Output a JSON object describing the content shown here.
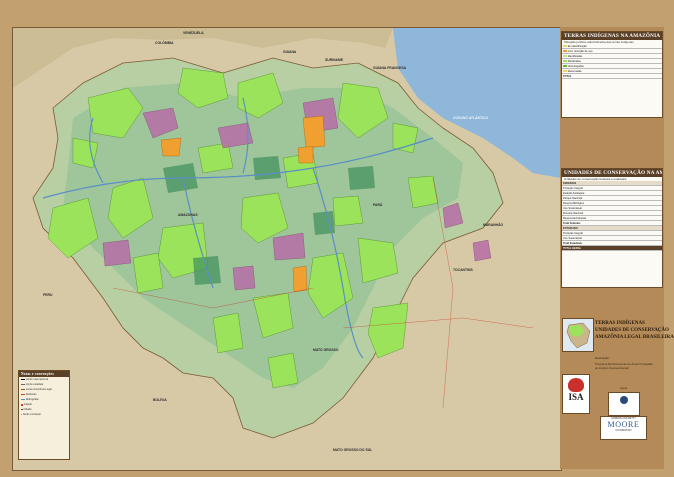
{
  "colors": {
    "indigenous_land": "#9be35a",
    "conservation_unit": "#b76ea7",
    "state_unit": "#3f8f5d",
    "orange_unit": "#f0a030",
    "ocean": "#8fb7d9",
    "frame": "#c2a06f"
  },
  "map": {
    "labels": {
      "colombia": "COLÔMBIA",
      "venezuela": "VENEZUELA",
      "guiana": "GUIANA",
      "suriname": "SURINAME",
      "guiana_fr": "GUIANA FRANCESA",
      "peru": "PERU",
      "bolivia": "BOLÍVIA",
      "ocean": "OCEANO ATLÂNTICO",
      "amazonas": "AMAZONAS",
      "para": "PARÁ",
      "maranhao": "MARANHÃO",
      "mato_grosso": "MATO GROSSO",
      "mato_grosso_sul": "MATO GROSSO DO SUL",
      "tocantins": "TOCANTINS"
    }
  },
  "panel_ti": {
    "title": "TERRAS INDÍGENAS NA AMAZÔNIA",
    "subtitle": "Situação jurídico-administrativa das terras indígenas",
    "rows": [
      "Em identificação",
      "Com restrição de uso",
      "Identificadas",
      "Declaradas",
      "Homologadas",
      "Reservadas"
    ],
    "total": "TOTAL"
  },
  "panel_uc": {
    "title": "UNIDADES DE CONSERVAÇÃO NA AMAZÔNIA",
    "subtitle": "Unidades de conservação federais e estaduais",
    "sections": [
      "FEDERAIS",
      "ESTADUAIS"
    ],
    "rows": [
      "Proteção Integral",
      "Estação Ecológica",
      "Parque Nacional",
      "Reserva Biológica",
      "Uso Sustentável",
      "Floresta Nacional",
      "Reserva Extrativista",
      "Total Federais",
      "Proteção Integral",
      "Uso Sustentável",
      "Total Estaduais"
    ],
    "total": "TOTAL GERAL"
  },
  "title_block": {
    "line1": "TERRAS INDÍGENAS",
    "line2": "UNIDADES DE CONSERVAÇÃO",
    "line3": "AMAZÔNIA LEGAL BRASILEIRA"
  },
  "credits": {
    "realizacao": "Realização:",
    "program": "Programa Monitoramento de Áreas Protegidas",
    "institute": "do Instituto Socioambiental",
    "apoio": "Apoio:",
    "isa": "ISA",
    "moore": "MOORE",
    "moore_sub": "GORDON AND BETTY",
    "moore_foundation": "FOUNDATION"
  },
  "legend": {
    "title": "Notas e convenções",
    "items": [
      "Limite internacional",
      "Limite estadual",
      "Limite Amazônia Legal",
      "Rodovias",
      "Hidrografia",
      "Capital",
      "Cidade",
      "Sede municipal"
    ]
  }
}
